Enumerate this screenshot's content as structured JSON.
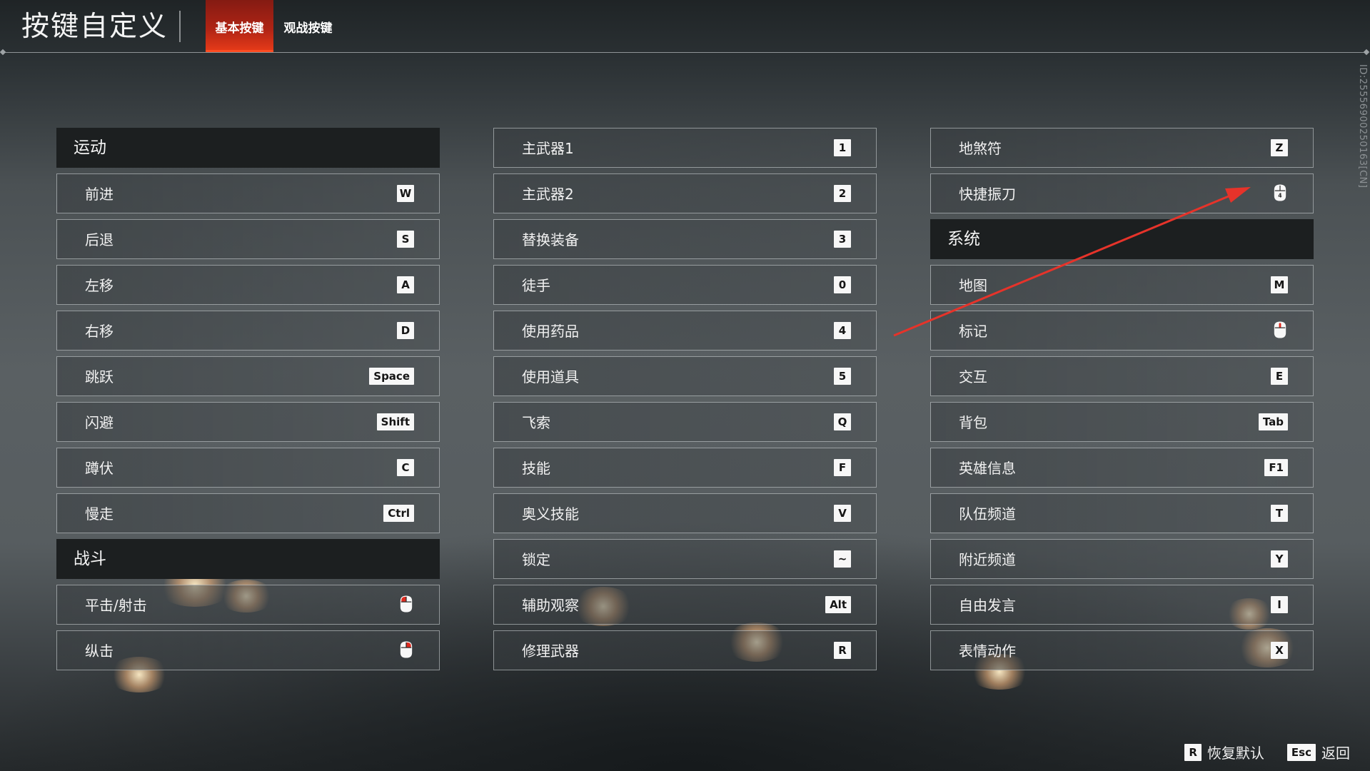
{
  "header": {
    "title": "按键自定义",
    "tabs": [
      {
        "label": "基本按键",
        "active": true
      },
      {
        "label": "观战按键",
        "active": false
      }
    ]
  },
  "accent_color": "#ff4b21",
  "version_id": "ID:255569002501​63[CN]",
  "columns": [
    {
      "rows": [
        {
          "type": "section",
          "label": "运动"
        },
        {
          "type": "bind",
          "label": "前进",
          "key": "W"
        },
        {
          "type": "bind",
          "label": "后退",
          "key": "S"
        },
        {
          "type": "bind",
          "label": "左移",
          "key": "A"
        },
        {
          "type": "bind",
          "label": "右移",
          "key": "D"
        },
        {
          "type": "bind",
          "label": "跳跃",
          "key": "Space"
        },
        {
          "type": "bind",
          "label": "闪避",
          "key": "Shift"
        },
        {
          "type": "bind",
          "label": "蹲伏",
          "key": "C"
        },
        {
          "type": "bind",
          "label": "慢走",
          "key": "Ctrl"
        },
        {
          "type": "section",
          "label": "战斗"
        },
        {
          "type": "bind",
          "label": "平击/射击",
          "icon": "mouse-left-icon"
        },
        {
          "type": "bind",
          "label": "纵击",
          "icon": "mouse-right-icon"
        }
      ]
    },
    {
      "rows": [
        {
          "type": "bind",
          "label": "主武器1",
          "key": "1"
        },
        {
          "type": "bind",
          "label": "主武器2",
          "key": "2"
        },
        {
          "type": "bind",
          "label": "替换装备",
          "key": "3"
        },
        {
          "type": "bind",
          "label": "徒手",
          "key": "0"
        },
        {
          "type": "bind",
          "label": "使用药品",
          "key": "4"
        },
        {
          "type": "bind",
          "label": "使用道具",
          "key": "5"
        },
        {
          "type": "bind",
          "label": "飞索",
          "key": "Q"
        },
        {
          "type": "bind",
          "label": "技能",
          "key": "F"
        },
        {
          "type": "bind",
          "label": "奥义技能",
          "key": "V"
        },
        {
          "type": "bind",
          "label": "锁定",
          "key": "~"
        },
        {
          "type": "bind",
          "label": "辅助观察",
          "key": "Alt"
        },
        {
          "type": "bind",
          "label": "修理武器",
          "key": "R"
        }
      ]
    },
    {
      "rows": [
        {
          "type": "bind",
          "label": "地煞符",
          "key": "Z"
        },
        {
          "type": "bind",
          "label": "快捷振刀",
          "icon": "mouse-side-icon"
        },
        {
          "type": "section",
          "label": "系统"
        },
        {
          "type": "bind",
          "label": "地图",
          "key": "M"
        },
        {
          "type": "bind",
          "label": "标记",
          "icon": "mouse-middle-icon"
        },
        {
          "type": "bind",
          "label": "交互",
          "key": "E"
        },
        {
          "type": "bind",
          "label": "背包",
          "key": "Tab"
        },
        {
          "type": "bind",
          "label": "英雄信息",
          "key": "F1"
        },
        {
          "type": "bind",
          "label": "队伍频道",
          "key": "T"
        },
        {
          "type": "bind",
          "label": "附近频道",
          "key": "Y"
        },
        {
          "type": "bind",
          "label": "自由发言",
          "key": "I"
        },
        {
          "type": "bind",
          "label": "表情动作",
          "key": "X"
        }
      ]
    }
  ],
  "footer": [
    {
      "key": "R",
      "label": "恢复默认"
    },
    {
      "key": "Esc",
      "label": "返回"
    }
  ]
}
